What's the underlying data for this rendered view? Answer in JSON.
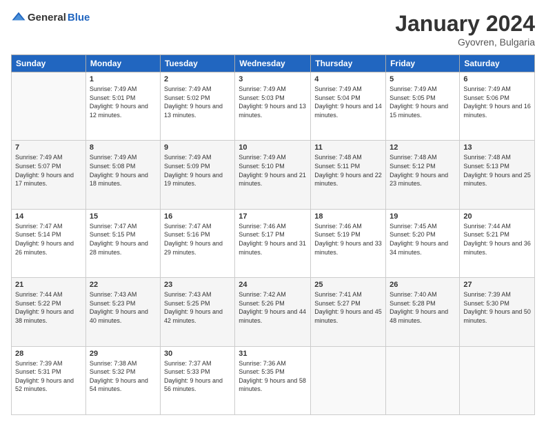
{
  "header": {
    "logo": {
      "general": "General",
      "blue": "Blue"
    },
    "title": "January 2024",
    "subtitle": "Gyovren, Bulgaria"
  },
  "days": [
    "Sunday",
    "Monday",
    "Tuesday",
    "Wednesday",
    "Thursday",
    "Friday",
    "Saturday"
  ],
  "weeks": [
    [
      {
        "num": "",
        "sunrise": "",
        "sunset": "",
        "daylight": ""
      },
      {
        "num": "1",
        "sunrise": "Sunrise: 7:49 AM",
        "sunset": "Sunset: 5:01 PM",
        "daylight": "Daylight: 9 hours and 12 minutes."
      },
      {
        "num": "2",
        "sunrise": "Sunrise: 7:49 AM",
        "sunset": "Sunset: 5:02 PM",
        "daylight": "Daylight: 9 hours and 13 minutes."
      },
      {
        "num": "3",
        "sunrise": "Sunrise: 7:49 AM",
        "sunset": "Sunset: 5:03 PM",
        "daylight": "Daylight: 9 hours and 13 minutes."
      },
      {
        "num": "4",
        "sunrise": "Sunrise: 7:49 AM",
        "sunset": "Sunset: 5:04 PM",
        "daylight": "Daylight: 9 hours and 14 minutes."
      },
      {
        "num": "5",
        "sunrise": "Sunrise: 7:49 AM",
        "sunset": "Sunset: 5:05 PM",
        "daylight": "Daylight: 9 hours and 15 minutes."
      },
      {
        "num": "6",
        "sunrise": "Sunrise: 7:49 AM",
        "sunset": "Sunset: 5:06 PM",
        "daylight": "Daylight: 9 hours and 16 minutes."
      }
    ],
    [
      {
        "num": "7",
        "sunrise": "Sunrise: 7:49 AM",
        "sunset": "Sunset: 5:07 PM",
        "daylight": "Daylight: 9 hours and 17 minutes."
      },
      {
        "num": "8",
        "sunrise": "Sunrise: 7:49 AM",
        "sunset": "Sunset: 5:08 PM",
        "daylight": "Daylight: 9 hours and 18 minutes."
      },
      {
        "num": "9",
        "sunrise": "Sunrise: 7:49 AM",
        "sunset": "Sunset: 5:09 PM",
        "daylight": "Daylight: 9 hours and 19 minutes."
      },
      {
        "num": "10",
        "sunrise": "Sunrise: 7:49 AM",
        "sunset": "Sunset: 5:10 PM",
        "daylight": "Daylight: 9 hours and 21 minutes."
      },
      {
        "num": "11",
        "sunrise": "Sunrise: 7:48 AM",
        "sunset": "Sunset: 5:11 PM",
        "daylight": "Daylight: 9 hours and 22 minutes."
      },
      {
        "num": "12",
        "sunrise": "Sunrise: 7:48 AM",
        "sunset": "Sunset: 5:12 PM",
        "daylight": "Daylight: 9 hours and 23 minutes."
      },
      {
        "num": "13",
        "sunrise": "Sunrise: 7:48 AM",
        "sunset": "Sunset: 5:13 PM",
        "daylight": "Daylight: 9 hours and 25 minutes."
      }
    ],
    [
      {
        "num": "14",
        "sunrise": "Sunrise: 7:47 AM",
        "sunset": "Sunset: 5:14 PM",
        "daylight": "Daylight: 9 hours and 26 minutes."
      },
      {
        "num": "15",
        "sunrise": "Sunrise: 7:47 AM",
        "sunset": "Sunset: 5:15 PM",
        "daylight": "Daylight: 9 hours and 28 minutes."
      },
      {
        "num": "16",
        "sunrise": "Sunrise: 7:47 AM",
        "sunset": "Sunset: 5:16 PM",
        "daylight": "Daylight: 9 hours and 29 minutes."
      },
      {
        "num": "17",
        "sunrise": "Sunrise: 7:46 AM",
        "sunset": "Sunset: 5:17 PM",
        "daylight": "Daylight: 9 hours and 31 minutes."
      },
      {
        "num": "18",
        "sunrise": "Sunrise: 7:46 AM",
        "sunset": "Sunset: 5:19 PM",
        "daylight": "Daylight: 9 hours and 33 minutes."
      },
      {
        "num": "19",
        "sunrise": "Sunrise: 7:45 AM",
        "sunset": "Sunset: 5:20 PM",
        "daylight": "Daylight: 9 hours and 34 minutes."
      },
      {
        "num": "20",
        "sunrise": "Sunrise: 7:44 AM",
        "sunset": "Sunset: 5:21 PM",
        "daylight": "Daylight: 9 hours and 36 minutes."
      }
    ],
    [
      {
        "num": "21",
        "sunrise": "Sunrise: 7:44 AM",
        "sunset": "Sunset: 5:22 PM",
        "daylight": "Daylight: 9 hours and 38 minutes."
      },
      {
        "num": "22",
        "sunrise": "Sunrise: 7:43 AM",
        "sunset": "Sunset: 5:23 PM",
        "daylight": "Daylight: 9 hours and 40 minutes."
      },
      {
        "num": "23",
        "sunrise": "Sunrise: 7:43 AM",
        "sunset": "Sunset: 5:25 PM",
        "daylight": "Daylight: 9 hours and 42 minutes."
      },
      {
        "num": "24",
        "sunrise": "Sunrise: 7:42 AM",
        "sunset": "Sunset: 5:26 PM",
        "daylight": "Daylight: 9 hours and 44 minutes."
      },
      {
        "num": "25",
        "sunrise": "Sunrise: 7:41 AM",
        "sunset": "Sunset: 5:27 PM",
        "daylight": "Daylight: 9 hours and 45 minutes."
      },
      {
        "num": "26",
        "sunrise": "Sunrise: 7:40 AM",
        "sunset": "Sunset: 5:28 PM",
        "daylight": "Daylight: 9 hours and 48 minutes."
      },
      {
        "num": "27",
        "sunrise": "Sunrise: 7:39 AM",
        "sunset": "Sunset: 5:30 PM",
        "daylight": "Daylight: 9 hours and 50 minutes."
      }
    ],
    [
      {
        "num": "28",
        "sunrise": "Sunrise: 7:39 AM",
        "sunset": "Sunset: 5:31 PM",
        "daylight": "Daylight: 9 hours and 52 minutes."
      },
      {
        "num": "29",
        "sunrise": "Sunrise: 7:38 AM",
        "sunset": "Sunset: 5:32 PM",
        "daylight": "Daylight: 9 hours and 54 minutes."
      },
      {
        "num": "30",
        "sunrise": "Sunrise: 7:37 AM",
        "sunset": "Sunset: 5:33 PM",
        "daylight": "Daylight: 9 hours and 56 minutes."
      },
      {
        "num": "31",
        "sunrise": "Sunrise: 7:36 AM",
        "sunset": "Sunset: 5:35 PM",
        "daylight": "Daylight: 9 hours and 58 minutes."
      },
      {
        "num": "",
        "sunrise": "",
        "sunset": "",
        "daylight": ""
      },
      {
        "num": "",
        "sunrise": "",
        "sunset": "",
        "daylight": ""
      },
      {
        "num": "",
        "sunrise": "",
        "sunset": "",
        "daylight": ""
      }
    ]
  ]
}
